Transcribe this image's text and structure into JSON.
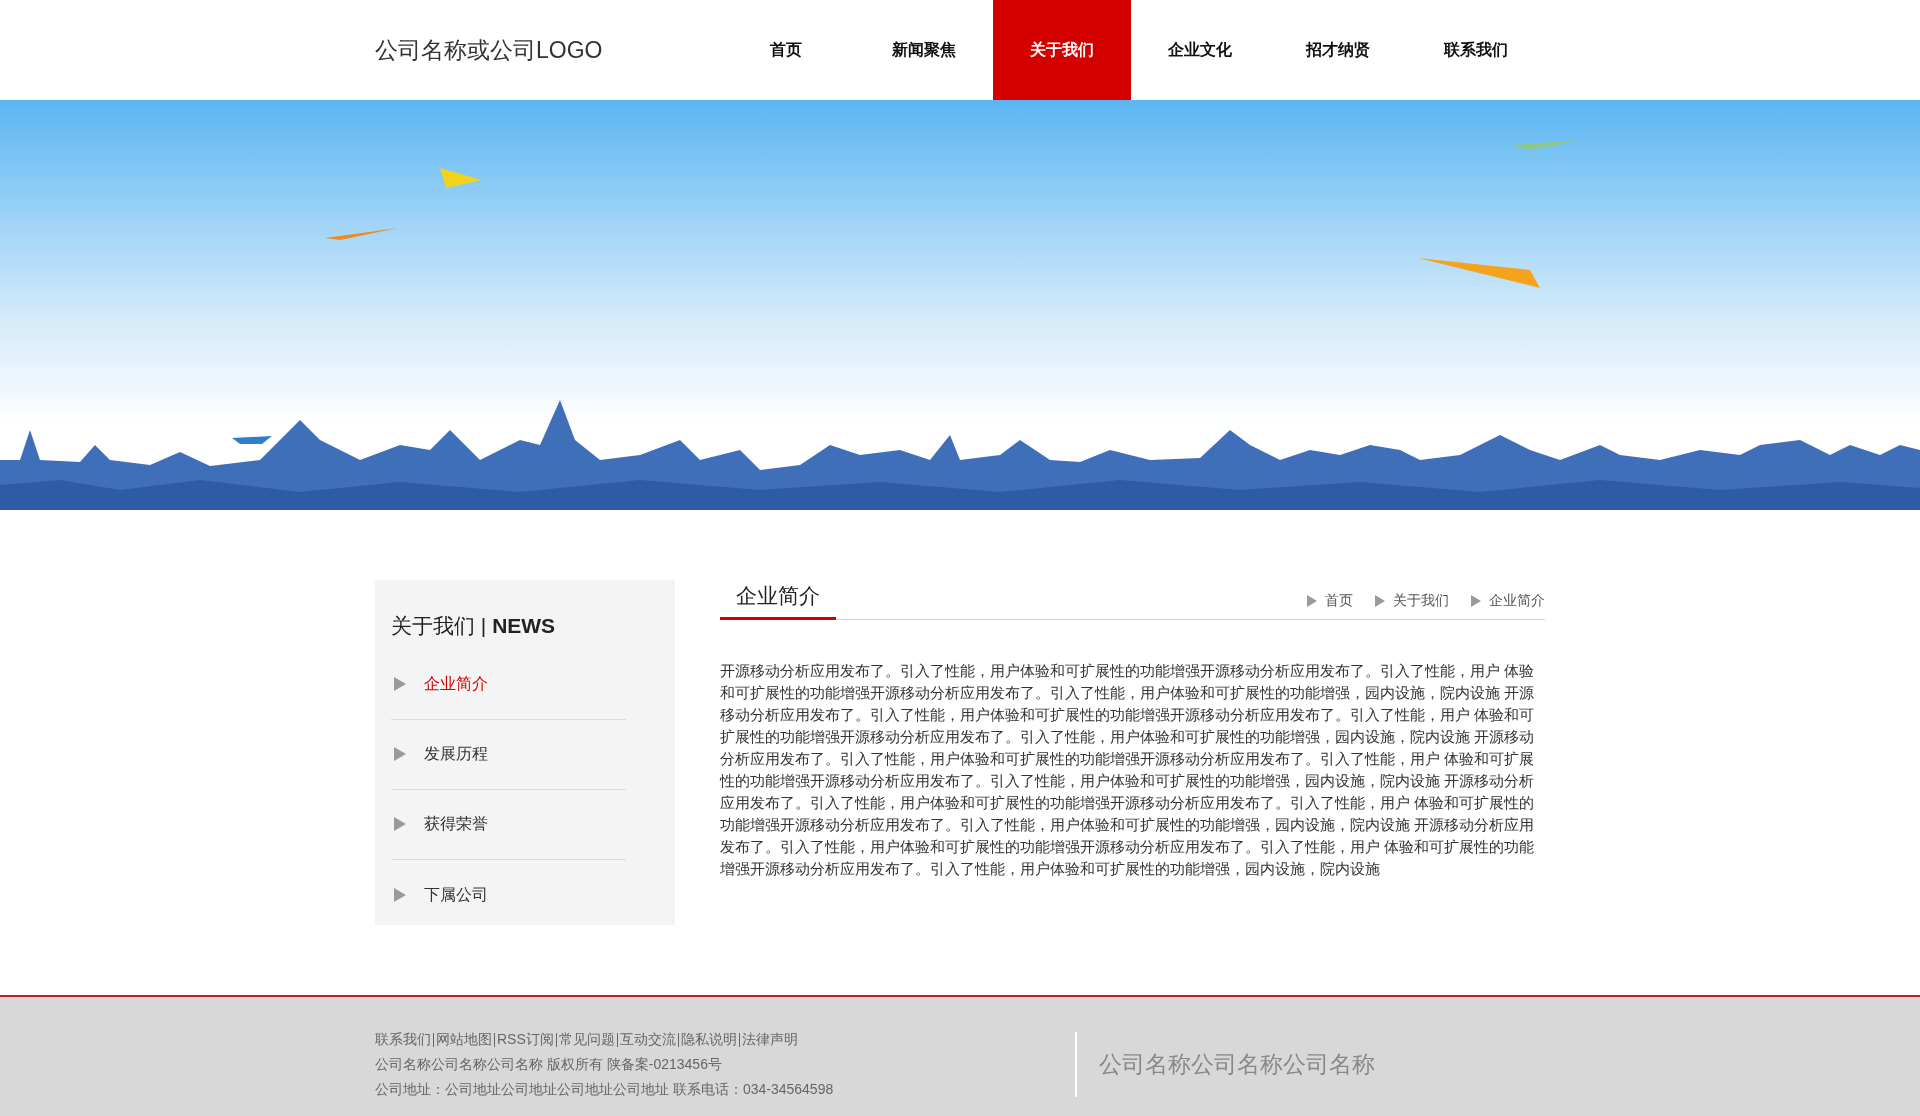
{
  "header": {
    "logo": "公司名称或公司LOGO",
    "nav": [
      {
        "label": "首页",
        "selected": false
      },
      {
        "label": "新闻聚焦",
        "selected": false
      },
      {
        "label": "关于我们",
        "selected": true
      },
      {
        "label": "企业文化",
        "selected": false
      },
      {
        "label": "招才纳贤",
        "selected": false
      },
      {
        "label": "联系我们",
        "selected": false
      }
    ]
  },
  "sidebar": {
    "title": "关于我们 | **NEWS**",
    "items": [
      {
        "label": "企业简介",
        "selected": true
      },
      {
        "label": "发展历程",
        "selected": false
      },
      {
        "label": "获得荣誉",
        "selected": false
      },
      {
        "label": "下属公司",
        "selected": false
      }
    ]
  },
  "content": {
    "title": "企业简介",
    "breadcrumb": [
      "首页",
      "关于我们",
      "企业简介"
    ],
    "body": "开源移动分析应用发布了。引入了性能，用户体验和可扩展性的功能增强开源移动分析应用发布了。引入了性能，用户 体验和可扩展性的功能增强开源移动分析应用发布了。引入了性能，用户体验和可扩展性的功能增强，园内设施，院内设施 开源移动分析应用发布了。引入了性能，用户体验和可扩展性的功能增强开源移动分析应用发布了。引入了性能，用户 体验和可扩展性的功能增强开源移动分析应用发布了。引入了性能，用户体验和可扩展性的功能增强，园内设施，院内设施 开源移动分析应用发布了。引入了性能，用户体验和可扩展性的功能增强开源移动分析应用发布了。引入了性能，用户 体验和可扩展性的功能增强开源移动分析应用发布了。引入了性能，用户体验和可扩展性的功能增强，园内设施，院内设施 开源移动分析应用发布了。引入了性能，用户体验和可扩展性的功能增强开源移动分析应用发布了。引入了性能，用户 体验和可扩展性的功能增强开源移动分析应用发布了。引入了性能，用户体验和可扩展性的功能增强，园内设施，院内设施 开源移动分析应用发布了。引入了性能，用户体验和可扩展性的功能增强开源移动分析应用发布了。引入了性能，用户 体验和可扩展性的功能增强开源移动分析应用发布了。引入了性能，用户体验和可扩展性的功能增强，园内设施，院内设施"
  },
  "footer": {
    "links": [
      "联系我们",
      "网站地图",
      "RSS订阅",
      "常见问题",
      "互动交流",
      "隐私说明",
      "法律声明"
    ],
    "copyright": "公司名称公司名称公司名称 版权所有 陕备案-0213456号",
    "address": "公司地址：公司地址公司地址公司地址公司地址 联系电话：034-34564598",
    "company": "公司名称公司名称公司名称"
  }
}
